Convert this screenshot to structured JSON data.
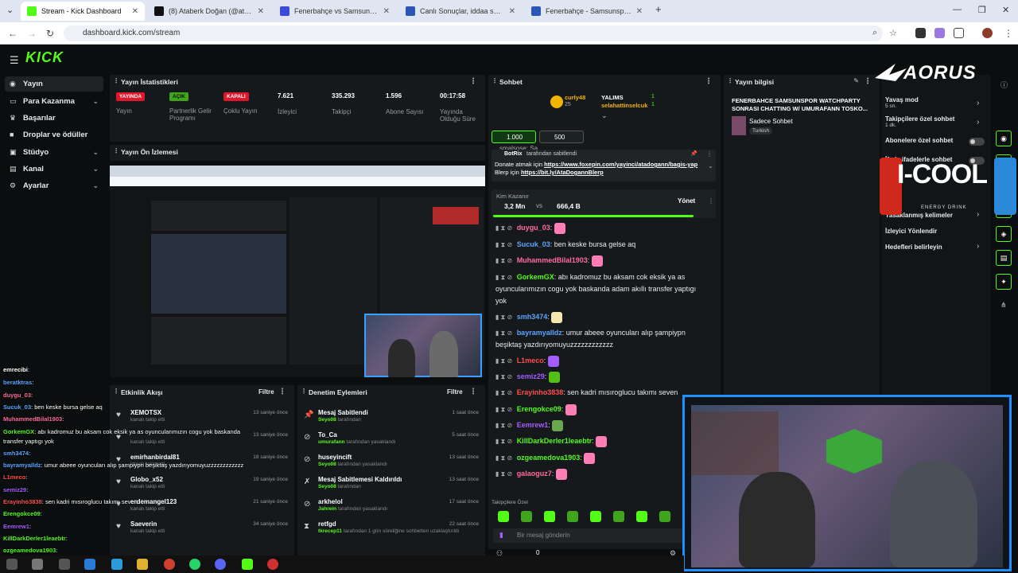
{
  "browser": {
    "tabs": [
      {
        "label": "Stream - Kick Dashboard",
        "color": "#53fc18"
      },
      {
        "label": "(8) Ataberk Doğan (@atadogan",
        "color": "#111111"
      },
      {
        "label": "Fenerbahçe vs Samsunspor live",
        "color": "#3b4bd8"
      },
      {
        "label": "Canlı Sonuçlar, iddaa sonuçları",
        "color": "#2d55b5"
      },
      {
        "label": "Fenerbahçe - Samsunspor (6.0",
        "color": "#2d55b5"
      }
    ],
    "url": "dashboard.kick.com/stream"
  },
  "app": {
    "logo": "KICK",
    "sidebar": [
      {
        "label": "Yayın",
        "icon": "broadcast-icon",
        "chevron": false
      },
      {
        "label": "Para Kazanma",
        "icon": "wallet-icon",
        "chevron": true
      },
      {
        "label": "Başarılar",
        "icon": "trophy-icon",
        "chevron": false
      },
      {
        "label": "Droplar ve ödüller",
        "icon": "gift-icon",
        "chevron": false
      },
      {
        "label": "Stüdyo",
        "icon": "studio-icon",
        "chevron": true
      },
      {
        "label": "Kanal",
        "icon": "channel-icon",
        "chevron": true
      },
      {
        "label": "Ayarlar",
        "icon": "gear-icon",
        "chevron": true
      }
    ]
  },
  "stats": {
    "title": "Yayın İstatistikleri",
    "items": [
      {
        "badge": "YAYINDA",
        "badge_color": "#e0162b",
        "label": "Yayın"
      },
      {
        "badge": "AÇIK",
        "badge_color": "#3fa51b",
        "label": "Partnerlik Gelir Programı"
      },
      {
        "badge": "KAPALI",
        "badge_color": "#e0162b",
        "label": "Çoklu Yayın"
      },
      {
        "value": "7.621",
        "label": "İzleyici"
      },
      {
        "value": "335.293",
        "label": "Takipçi"
      },
      {
        "value": "1.596",
        "label": "Abone Sayısı"
      },
      {
        "value": "00:17:58",
        "label": "Yayında Olduğu Süre"
      }
    ]
  },
  "preview": {
    "title": "Yayın Ön İzlemesi"
  },
  "activity": {
    "title": "Etkinlik Akışı",
    "filter": "Filtre",
    "rows": [
      {
        "name": "XEMOTSX",
        "sub": "kanalı takip etti",
        "time": "13 saniye önce"
      },
      {
        "name": "",
        "sub": "kanalı takip etti",
        "time": "13 saniye önce"
      },
      {
        "name": "emirhanbirdal81",
        "sub": "kanalı takip etti",
        "time": "18 saniye önce"
      },
      {
        "name": "Globo_x52",
        "sub": "kanalı takip etti",
        "time": "19 saniye önce"
      },
      {
        "name": "erdemangel123",
        "sub": "kanalı takip etti",
        "time": "21 saniye önce"
      },
      {
        "name": "Saeverin",
        "sub": "kanalı takip etti",
        "time": "34 saniye önce"
      }
    ]
  },
  "moderation": {
    "title": "Denetim Eylemleri",
    "filter": "Filtre",
    "rows": [
      {
        "icon": "pin-icon",
        "title": "Mesaj Sabitlendi",
        "actor": "Seyo08",
        "action": "tarafından",
        "time": "1 saat önce"
      },
      {
        "icon": "ban-icon",
        "title": "To_Ca",
        "actor": "umurafann",
        "action": "tarafından yasaklandı",
        "time": "5 saat önce"
      },
      {
        "icon": "ban-icon",
        "title": "huseyincift",
        "actor": "Seyo08",
        "action": "tarafından yasaklandı",
        "time": "13 saat önce"
      },
      {
        "icon": "unpin-icon",
        "title": "Mesaj Sabitlemesi Kaldırıldı",
        "actor": "Seyo08",
        "action": "tarafından",
        "time": "13 saat önce"
      },
      {
        "icon": "ban-icon",
        "title": "arkhelol",
        "actor": "Jahrein",
        "action": "tarafından yasaklandı",
        "time": "17 saat önce"
      },
      {
        "icon": "timeout-icon",
        "title": "retfgd",
        "actor": "tkrecep11",
        "action": "tarafından 1 gün süreliğine sohbetten uzaklaştırıldı",
        "time": "22 saat önce"
      }
    ]
  },
  "chat": {
    "title": "Sohbet",
    "top_user": "curly48",
    "top_count": "25",
    "gifters": [
      {
        "name": "YALIMS",
        "count": "1"
      },
      {
        "name": "selahattinselcuk",
        "count": "1"
      }
    ],
    "pills": [
      "1.000",
      "500"
    ],
    "partial_top": "smalsose: Sa",
    "pinned": {
      "bot": "BotRix",
      "by": "tarafından sabitlendi",
      "text1": "Donate atmak için",
      "link1": "https://www.foxepin.com/yayinci/atadogann/bagis-yap",
      "text2": "Blerp için",
      "link2": "https://bit.ly/AtaDogannBlerp"
    },
    "prediction": {
      "title": "Kim Kazanır",
      "left": "3,2 Mn",
      "vs": "vs",
      "right": "666,4 B",
      "manage": "Yönet"
    },
    "messages": [
      {
        "user": "duygu_03",
        "color": "#ff6b9a",
        "text": "",
        "emote": "#ff7eb6"
      },
      {
        "user": "Sucuk_03",
        "color": "#5aa5ff",
        "text": "ben keske bursa gelse aq",
        "emote": ""
      },
      {
        "user": "MuhammedBilal1903",
        "color": "#ff6b9a",
        "text": "",
        "emote": "#ff7eb6"
      },
      {
        "user": "GorkemGX",
        "color": "#53fc18",
        "text": "abı kadromuz bu aksam cok eksik ya as oyuncularımızın cogu yok baskanda adam akıllı transfer yaptıgı yok",
        "emote": ""
      },
      {
        "user": "smh3474",
        "color": "#5aa5ff",
        "text": "",
        "emote": "#f5e6b0"
      },
      {
        "user": "bayramyalldz",
        "color": "#5aa5ff",
        "text": "umur abeee oyuncuları alıp şampiypn beşiktaş yazdırıyomuyuzzzzzzzzzzzz",
        "emote": ""
      },
      {
        "user": "L1meco",
        "color": "#ff4d4d",
        "text": "",
        "emote": "#a45cff"
      },
      {
        "user": "semiz29",
        "color": "#a45cff",
        "text": "",
        "emote": "#53c018"
      },
      {
        "user": "Erayinho3838",
        "color": "#ff4d4d",
        "text": "sen kadri mısıroglucu takımı seven",
        "emote": ""
      },
      {
        "user": "Erengokce09",
        "color": "#53fc18",
        "text": "",
        "emote": "#ff7eb6"
      },
      {
        "user": "Eemrew1",
        "color": "#a45cff",
        "text": "",
        "emote": "#6aa84f"
      },
      {
        "user": "KillDarkDerler1leaebtr",
        "color": "#53fc18",
        "text": "",
        "emote": "#ff7eb6"
      },
      {
        "user": "ozgeamedova1903",
        "color": "#53fc18",
        "text": "",
        "emote": "#ff7eb6"
      },
      {
        "user": "galaoguz7",
        "color": "#ff6b9a",
        "text": "",
        "emote": "#ff7eb6"
      }
    ],
    "followers_only": "Takipçilere Özel",
    "input_placeholder": "Bir mesaj gönderin",
    "points": "0"
  },
  "info": {
    "title": "Yayın bilgisi",
    "stream_title": "FENERBAHCE SAMSUNSPOR WATCHPARTY SONRASI CHATTING W/ UMURAFANN TOSKO...",
    "category": "Sadece Sohbet",
    "language": "Turkish"
  },
  "chat_settings": {
    "rows": [
      {
        "label": "Yavaş mod",
        "sub": "5 sn.",
        "kind": "chevron"
      },
      {
        "label": "Takipçilere özel sohbet",
        "sub": "1 dk.",
        "kind": "chevron"
      },
      {
        "label": "Abonelere özel sohbet",
        "sub": "",
        "kind": "toggle"
      },
      {
        "label": "İfade ifadelerle sohbet",
        "sub": "",
        "kind": "toggle"
      },
      {
        "label": "Yasaklanmış kelimeler",
        "sub": "",
        "kind": "chevron"
      },
      {
        "label": "İzleyici Yönlendir",
        "sub": "",
        "kind": "none"
      },
      {
        "label": "Hedefleri belirleyin",
        "sub": "",
        "kind": "chevron"
      }
    ]
  },
  "overlay": {
    "brand_top": "AORUS",
    "brand_can": "I-COOL",
    "brand_can_sub": "ENERGY DRINK",
    "chat": [
      {
        "user": "emrecibi",
        "color": "#ffffff",
        "text": ""
      },
      {
        "user": "beratktras",
        "color": "#5aa5ff",
        "text": ""
      },
      {
        "user": "duygu_03",
        "color": "#ff6b9a",
        "text": ""
      },
      {
        "user": "Sucuk_03",
        "color": "#5aa5ff",
        "text": "ben keske bursa gelse aq"
      },
      {
        "user": "MuhammedBilal1903",
        "color": "#ff6b9a",
        "text": ""
      },
      {
        "user": "GorkemGX",
        "color": "#53fc18",
        "text": "abı kadromuz bu aksam cok eksik ya as oyuncularımızın cogu yok baskanda"
      },
      {
        "user": "",
        "color": "#ffffff",
        "text": "transfer yaptıgı yok"
      },
      {
        "user": "smh3474",
        "color": "#5aa5ff",
        "text": ""
      },
      {
        "user": "bayramyalldz",
        "color": "#5aa5ff",
        "text": "umur abeee oyuncuları alıp şampiypn beşiktaş yazdırıyomuyuzzzzzzzzzzzz"
      },
      {
        "user": "L1meco",
        "color": "#ff4d4d",
        "text": ""
      },
      {
        "user": "semiz29",
        "color": "#a45cff",
        "text": ""
      },
      {
        "user": "Erayinho3838",
        "color": "#ff4d4d",
        "text": "sen kadri mısıroglucu takımı seven"
      },
      {
        "user": "Erengokce09",
        "color": "#53fc18",
        "text": ""
      },
      {
        "user": "Eemrew1",
        "color": "#a45cff",
        "text": ""
      },
      {
        "user": "KillDarkDerler1leaebtr",
        "color": "#53fc18",
        "text": ""
      },
      {
        "user": "ozgeamedova1903",
        "color": "#53fc18",
        "text": ""
      },
      {
        "user": "galaoguz7",
        "color": "#ff6b9a",
        "text": ""
      }
    ]
  }
}
